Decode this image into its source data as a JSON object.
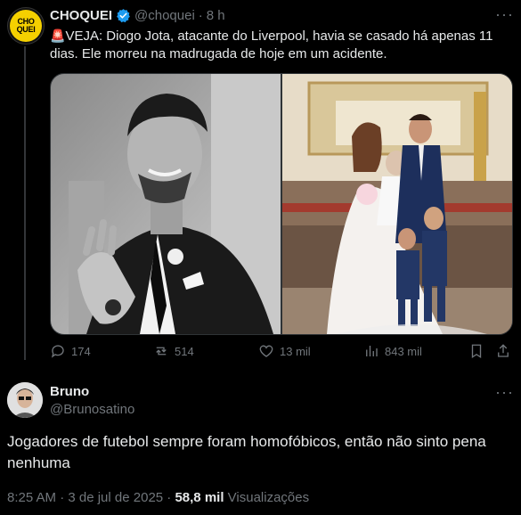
{
  "tweet": {
    "author_name": "CHOQUEI",
    "handle": "@choquei",
    "separator": "·",
    "time": "8 h",
    "siren_emoji": "🚨",
    "text": "VEJA: Diogo Jota, atacante do Liverpool, havia se casado há apenas 11 dias. Ele morreu na madrugada de hoje em um acidente.",
    "avatar_text": "CHO QUEI",
    "stats": {
      "replies": "174",
      "reposts": "514",
      "likes": "13 mil",
      "views": "843 mil"
    }
  },
  "reply": {
    "author_name": "Bruno",
    "handle": "@Brunosatino",
    "text": "Jogadores de futebol sempre foram homofóbicos, então não sinto pena nenhuma",
    "timestamp": "8:25 AM · 3 de jul de 2025 · ",
    "views_count": "58,8 mil",
    "views_label": " Visualizações"
  },
  "colors": {
    "background": "#000000",
    "text": "#e7e9ea",
    "muted": "#71767b",
    "verified": "#1d9bf0",
    "brand_yellow": "#f5d000"
  },
  "icons": [
    "verified-badge-icon",
    "more-icon",
    "reply-icon",
    "repost-icon",
    "like-icon",
    "views-icon",
    "bookmark-icon",
    "share-icon"
  ]
}
